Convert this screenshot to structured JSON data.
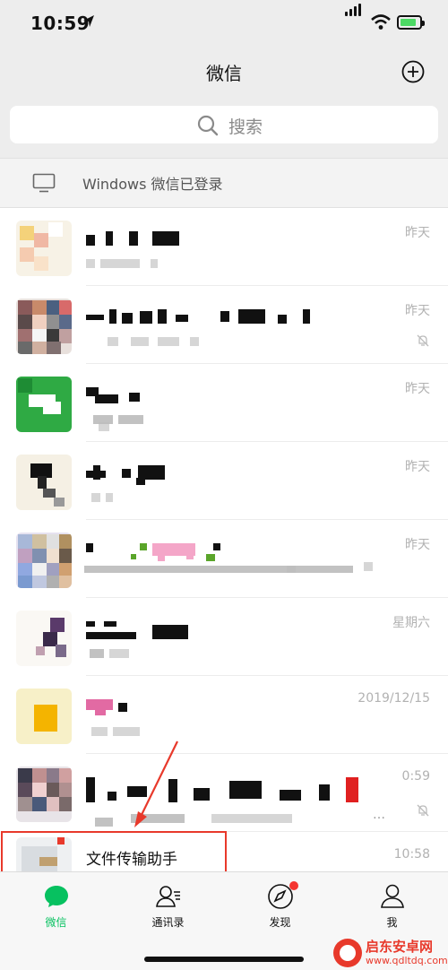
{
  "status_bar": {
    "time": "10:59"
  },
  "nav": {
    "title": "微信"
  },
  "search": {
    "placeholder": "搜索"
  },
  "login_banner": {
    "text": "Windows 微信已登录"
  },
  "chats": [
    {
      "time": "昨天",
      "muted": false
    },
    {
      "time": "昨天",
      "muted": true
    },
    {
      "time": "昨天",
      "muted": false
    },
    {
      "time": "昨天",
      "muted": false
    },
    {
      "time": "昨天",
      "muted": false
    },
    {
      "time": "星期六",
      "muted": false
    },
    {
      "time": "2019/12/15",
      "muted": false
    },
    {
      "time": "0:59",
      "muted": true,
      "preview_tail": "…"
    },
    {
      "name": "文件传输助手",
      "time": "10:58",
      "muted": false
    }
  ],
  "tabbar": {
    "tabs": [
      {
        "label": "微信",
        "icon": "chat-bubble-icon",
        "active": true
      },
      {
        "label": "通讯录",
        "icon": "contacts-icon",
        "active": false
      },
      {
        "label": "发现",
        "icon": "compass-icon",
        "active": false,
        "badge_dot": true
      },
      {
        "label": "我",
        "icon": "person-icon",
        "active": false
      }
    ]
  },
  "watermark": {
    "brand": "启东安卓网",
    "url": "www.qdltdq.com"
  },
  "colors": {
    "accent": "#07c160",
    "highlight": "#e8392b",
    "badge": "#f43530"
  }
}
